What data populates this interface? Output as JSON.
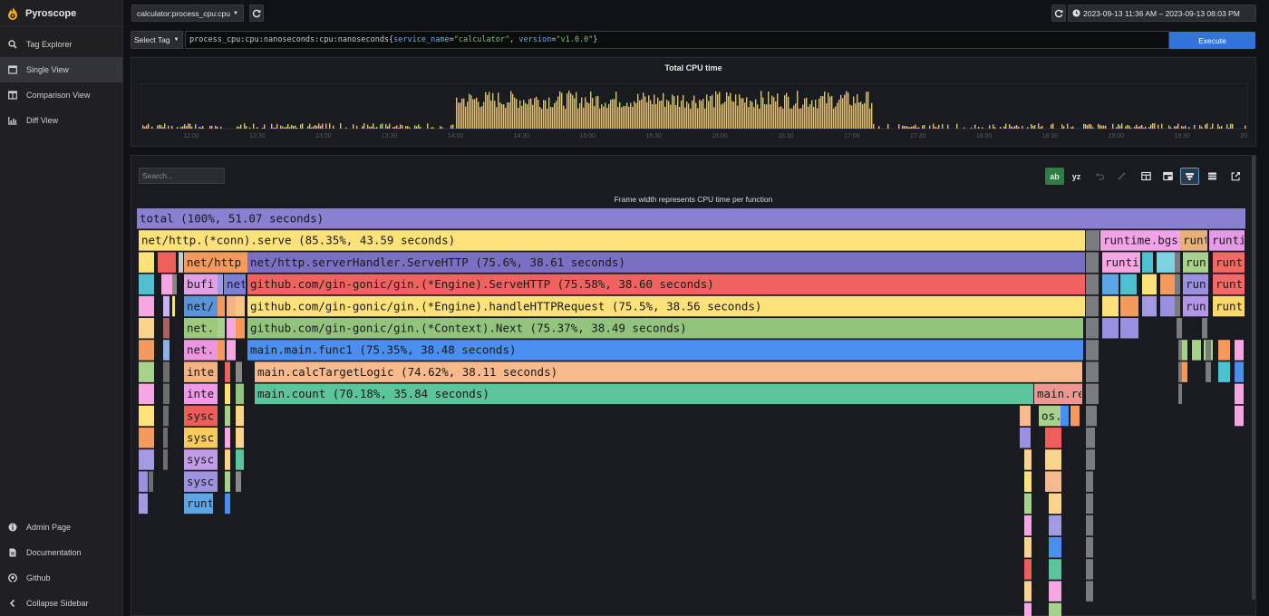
{
  "sidebar": {
    "brand": "Pyroscope",
    "items": [
      {
        "label": "Tag Explorer",
        "icon": "search-icon",
        "active": false
      },
      {
        "label": "Single View",
        "icon": "window-icon",
        "active": true
      },
      {
        "label": "Comparison View",
        "icon": "columns-icon",
        "active": false
      },
      {
        "label": "Diff View",
        "icon": "chart-icon",
        "active": false
      }
    ],
    "bottom_items": [
      {
        "label": "Admin Page",
        "icon": "info-icon"
      },
      {
        "label": "Documentation",
        "icon": "file-icon"
      },
      {
        "label": "Github",
        "icon": "github-icon"
      },
      {
        "label": "Collapse Sidebar",
        "icon": "chevron-left-icon"
      }
    ]
  },
  "toolbar": {
    "app_name": "calculator:process_cpu:cpu",
    "date_range": "2023-09-13 11:36 AM – 2023-09-13 08:03 PM"
  },
  "query": {
    "select_tag": "Select Tag",
    "prefix": "process_cpu:cpu:nanoseconds:cpu:nanoseconds{",
    "k1": "service_name",
    "v1": "\"calculator\"",
    "k2": "version",
    "v2": "\"v1.0.0\"",
    "suffix": "}",
    "execute": "Execute"
  },
  "timeline": {
    "title": "Total CPU time",
    "ticks": [
      "12:00",
      "12:30",
      "13:00",
      "13:30",
      "14:00",
      "14:30",
      "15:00",
      "15:30",
      "16:00",
      "16:30",
      "17:00",
      "17:30",
      "18:00",
      "18:30",
      "19:00",
      "19:30",
      "20:00"
    ],
    "bar_color": "#f2c232"
  },
  "flamegraph": {
    "search_placeholder": "Search...",
    "subtitle": "Frame width represents CPU time per function",
    "toolbar_text": {
      "ab": "ab",
      "yz": "yz"
    },
    "frames": [
      {
        "label": "total (100%, 51.07 seconds)",
        "color": "#8a7fd0"
      },
      {
        "label": "net/http.(*conn).serve (85.35%, 43.59 seconds)",
        "color": "#fde27a"
      },
      {
        "label": "net/http.serverHandler.ServeHTTP (75.6%, 38.61 seconds)",
        "color": "#7a6fc2"
      },
      {
        "label": "github.com/gin-gonic/gin.(*Engine).ServeHTTP (75.58%, 38.60 seconds)",
        "color": "#f0625f"
      },
      {
        "label": "github.com/gin-gonic/gin.(*Engine).handleHTTPRequest (75.5%, 38.56 seconds)",
        "color": "#fde27a"
      },
      {
        "label": "github.com/gin-gonic/gin.(*Context).Next (75.37%, 38.49 seconds)",
        "color": "#93c47d"
      },
      {
        "label": "main.main.func1 (75.35%, 38.48 seconds)",
        "color": "#4a8ff0"
      },
      {
        "label": "main.calcTargetLogic (74.62%, 38.11 seconds)",
        "color": "#f8b98c"
      },
      {
        "label": "main.count (70.18%, 35.84 seconds)",
        "color": "#5bc49a"
      },
      {
        "label": "runtime.bgs",
        "color": "#f2a3e8"
      },
      {
        "label": "runt",
        "color": "#e8b07a"
      },
      {
        "label": "runti",
        "color": "#e59ae8"
      },
      {
        "label": "net/http",
        "color": "#f39a5c"
      },
      {
        "label": "runti",
        "color": "#f5a6e3"
      },
      {
        "label": "run",
        "color": "#a8d28c"
      },
      {
        "label": "runt",
        "color": "#ee6a62"
      },
      {
        "label": "bufi",
        "color": "#e3a0e6"
      },
      {
        "label": "net",
        "color": "#7b7fd6"
      },
      {
        "label": "run",
        "color": "#9a8fe0"
      },
      {
        "label": "runt",
        "color": "#f16b66"
      },
      {
        "label": "net/",
        "color": "#5b93d8"
      },
      {
        "label": "run",
        "color": "#b396e8"
      },
      {
        "label": "runt",
        "color": "#fbd86e"
      },
      {
        "label": "net.",
        "color": "#9cc97c"
      },
      {
        "label": "net.",
        "color": "#ee95e0"
      },
      {
        "label": "inte",
        "color": "#f7b27e"
      },
      {
        "label": "main.re",
        "color": "#f09692"
      },
      {
        "label": "inte",
        "color": "#ee9ae8"
      },
      {
        "label": "os.",
        "color": "#a8d28c"
      },
      {
        "label": "sysc",
        "color": "#ed5d59"
      },
      {
        "label": "sysc",
        "color": "#f7ca5a"
      },
      {
        "label": "sysc",
        "color": "#c39ce8"
      },
      {
        "label": "sysc",
        "color": "#9f93e0"
      },
      {
        "label": "runt",
        "color": "#5aa6e6"
      }
    ]
  }
}
